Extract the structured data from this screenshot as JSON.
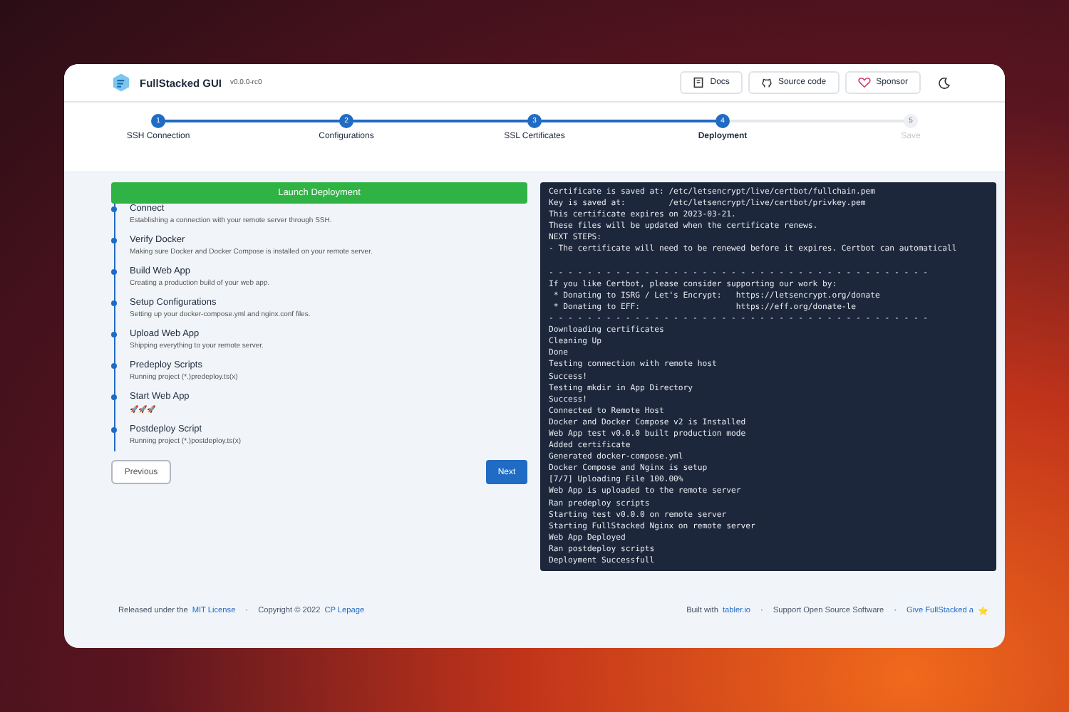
{
  "app": {
    "name": "FullStacked GUI",
    "version": "v0.0.0-rc0"
  },
  "header_buttons": [
    {
      "label": "Docs",
      "kind": "docs"
    },
    {
      "label": "Source code",
      "kind": "source"
    },
    {
      "label": "Sponsor",
      "kind": "sponsor"
    }
  ],
  "steps": [
    {
      "number": "1",
      "label": "SSH Connection",
      "completed": true,
      "selected": false
    },
    {
      "number": "2",
      "label": "Configurations",
      "completed": true,
      "selected": false
    },
    {
      "number": "3",
      "label": "SSL Certificates",
      "completed": true,
      "selected": false
    },
    {
      "number": "4",
      "label": "Deployment",
      "completed": true,
      "selected": true
    },
    {
      "number": "5",
      "label": "Save",
      "completed": false,
      "selected": false
    }
  ],
  "launch_button": "Launch Deployment",
  "tasks": [
    {
      "title": "Connect",
      "description": "Establishing a connection with your remote server through SSH."
    },
    {
      "title": "Verify Docker",
      "description": "Making sure Docker and Docker Compose is installed on your remote server."
    },
    {
      "title": "Build Web App",
      "description": "Creating a production build of your web app."
    },
    {
      "title": "Setup Configurations",
      "description": "Setting up your docker-compose.yml and nginx.conf files."
    },
    {
      "title": "Upload Web App",
      "description": "Shipping everything to your remote server."
    },
    {
      "title": "Predeploy Scripts",
      "description": "Running project (*.)predeploy.ts(x)"
    },
    {
      "title": "Start Web App",
      "description": "🚀🚀🚀"
    },
    {
      "title": "Postdeploy Script",
      "description": "Running project (*.)postdeploy.ts(x)"
    }
  ],
  "previous_button": "Previous",
  "next_button": "Next",
  "log_lines": [
    "Certificate is saved at: /etc/letsencrypt/live/certbot/fullchain.pem",
    "Key is saved at:         /etc/letsencrypt/live/certbot/privkey.pem",
    "This certificate expires on 2023-03-21.",
    "These files will be updated when the certificate renews.",
    "NEXT STEPS:",
    "- The certificate will need to be renewed before it expires. Certbot can automaticall",
    "\n- - - - - - - - - - - - - - - - - - - - - - - - - - - - - - - - - - - - - - - -",
    "If you like Certbot, please consider supporting our work by:",
    " * Donating to ISRG / Let's Encrypt:   https://letsencrypt.org/donate",
    " * Donating to EFF:                    https://eff.org/donate-le",
    "- - - - - - - - - - - - - - - - - - - - - - - - - - - - - - - - - - - - - - - -",
    "Downloading certificates",
    "Cleaning Up",
    "Done",
    "Testing connection with remote host",
    "Success!",
    "Testing mkdir in App Directory",
    "Success!",
    "Connected to Remote Host",
    "Docker and Docker Compose v2 is Installed",
    "Web App test v0.0.0 built production mode",
    "Added certificate",
    "Generated docker-compose.yml",
    "Docker Compose and Nginx is setup",
    "[7/7] Uploading File 100.00%",
    "Web App is uploaded to the remote server",
    "Ran predeploy scripts",
    "Starting test v0.0.0 on remote server",
    "Starting FullStacked Nginx on remote server",
    "Web App Deployed",
    "Ran postdeploy scripts",
    "Deployment Successfull"
  ],
  "footer": {
    "left": [
      {
        "kind": "text",
        "text": "Released under the"
      },
      {
        "kind": "link",
        "text": "MIT License"
      },
      {
        "kind": "sep",
        "text": "·"
      },
      {
        "kind": "text",
        "text": "Copyright © 2022"
      },
      {
        "kind": "link",
        "text": "CP Lepage"
      }
    ],
    "right": [
      {
        "kind": "text",
        "text": "Built with"
      },
      {
        "kind": "link",
        "text": "tabler.io"
      },
      {
        "kind": "sep",
        "text": "·"
      },
      {
        "kind": "text",
        "text": "Support Open Source Software"
      },
      {
        "kind": "sep",
        "text": "·"
      },
      {
        "kind": "link",
        "text": "Give FullStacked a"
      },
      {
        "kind": "star",
        "text": "⭐"
      }
    ]
  }
}
